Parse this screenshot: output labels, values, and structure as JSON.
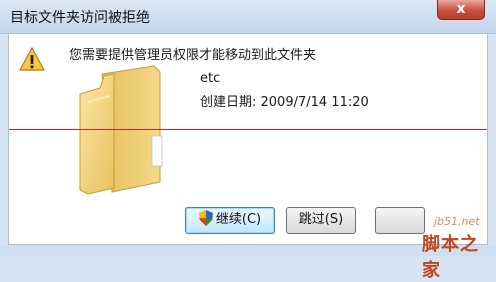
{
  "window": {
    "title": "目标文件夹访问被拒绝",
    "close_glyph": "x"
  },
  "dialog": {
    "message": "您需要提供管理员权限才能移动到此文件夹",
    "file": {
      "name": "etc",
      "date": "创建日期: 2009/7/14 11:20"
    },
    "buttons": {
      "continue": "继续(C)",
      "skip": "跳过(S)",
      "third": ""
    }
  },
  "watermark": {
    "url": "jb51.net",
    "name": "脚本之家"
  },
  "colors": {
    "red_line": "#c0282a",
    "folder": "#f2d27a",
    "warning": "#f6c843"
  },
  "icons": [
    "warning-icon",
    "folder-icon",
    "shield-icon",
    "close-icon"
  ]
}
